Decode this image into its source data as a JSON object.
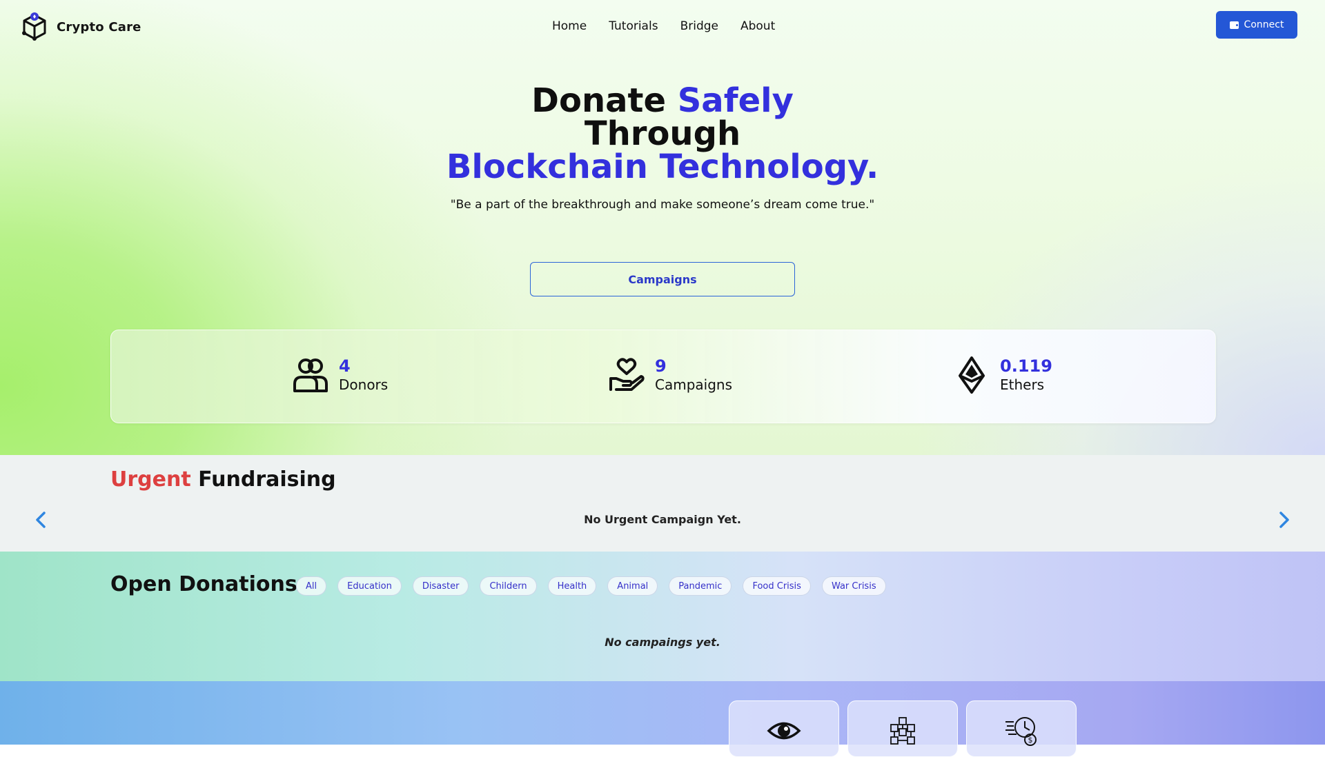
{
  "app": {
    "name": "Crypto Care",
    "logo_icon": "cube-logo-icon"
  },
  "nav": {
    "items": [
      {
        "label": "Home"
      },
      {
        "label": "Tutorials"
      },
      {
        "label": "Bridge"
      },
      {
        "label": "About"
      }
    ],
    "connect_label": "Connect",
    "connect_icon": "wallet-icon"
  },
  "hero": {
    "line1_a": "Donate",
    "line1_b": "Safely",
    "line2": "Through",
    "line3": "Blockchain Technology.",
    "quote": "\"Be a part of the breakthrough and make someone’s dream come true.\"",
    "cta_label": "Campaigns"
  },
  "stats": [
    {
      "value": "4",
      "label": "Donors",
      "icon": "donors-icon"
    },
    {
      "value": "9",
      "label": "Campaigns",
      "icon": "hand-heart-icon"
    },
    {
      "value": "0.119",
      "label": "Ethers",
      "icon": "ethereum-icon"
    }
  ],
  "urgent": {
    "title_a": "Urgent",
    "title_b": "Fundraising",
    "empty_text": "No Urgent Campaign Yet."
  },
  "open_donations": {
    "title": "Open Donations",
    "filters": [
      "All",
      "Education",
      "Disaster",
      "Childern",
      "Health",
      "Animal",
      "Pandemic",
      "Food Crisis",
      "War Crisis"
    ],
    "empty_text": "No campaings yet."
  },
  "features": [
    {
      "icon": "eye-icon"
    },
    {
      "icon": "blockchain-network-icon"
    },
    {
      "icon": "fast-money-clock-icon"
    }
  ],
  "colors": {
    "accent_blue": "#3330dd",
    "button_blue": "#2457d6",
    "urgent_red": "#dd4040"
  }
}
